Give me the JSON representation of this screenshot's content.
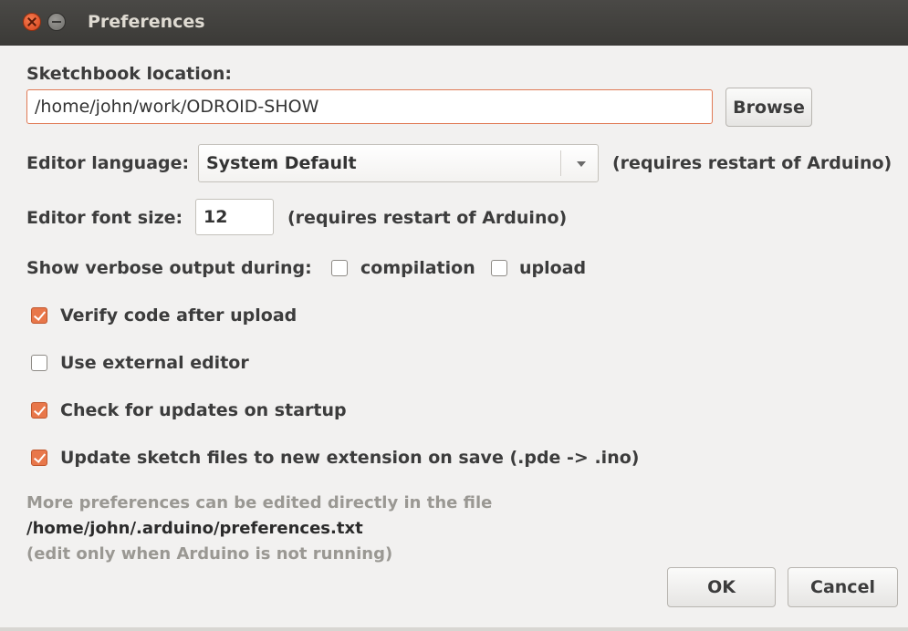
{
  "window": {
    "title": "Preferences"
  },
  "sketchbook": {
    "label": "Sketchbook location:",
    "path_value": "/home/john/work/ODROID-SHOW",
    "browse_label": "Browse"
  },
  "editor_language": {
    "label": "Editor language:",
    "selected": "System Default",
    "note": "(requires restart of Arduino)"
  },
  "editor_font_size": {
    "label": "Editor font size:",
    "value": "12",
    "note": "(requires restart of Arduino)"
  },
  "verbose": {
    "label": "Show verbose output during:",
    "compilation_label": "compilation",
    "compilation_checked": false,
    "upload_label": "upload",
    "upload_checked": false
  },
  "options": [
    {
      "label": "Verify code after upload",
      "checked": true
    },
    {
      "label": "Use external editor",
      "checked": false
    },
    {
      "label": "Check for updates on startup",
      "checked": true
    },
    {
      "label": "Update sketch files to new extension on save (.pde -> .ino)",
      "checked": true
    }
  ],
  "footer": {
    "more_prefs": "More preferences can be edited directly in the file",
    "prefs_path": "/home/john/.arduino/preferences.txt",
    "edit_note": "(edit only when Arduino is not running)"
  },
  "buttons": {
    "ok": "OK",
    "cancel": "Cancel"
  },
  "colors": {
    "accent": "#e8774a",
    "titlebar": "#3c3b37",
    "background": "#f2f1f0"
  }
}
